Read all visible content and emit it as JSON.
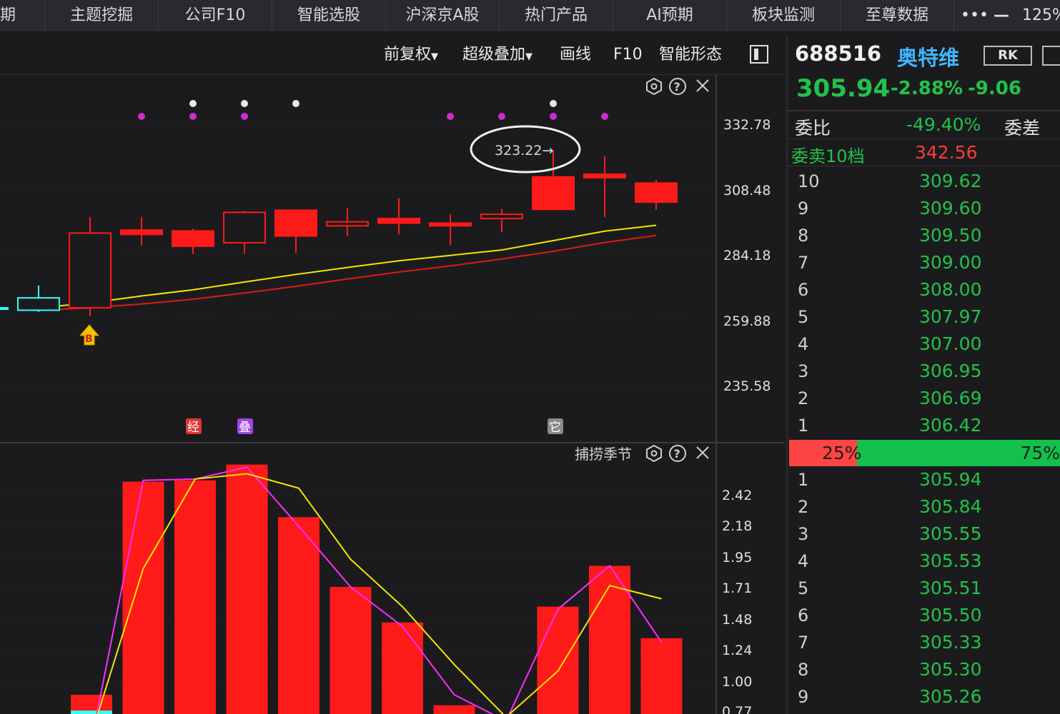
{
  "topnav": {
    "tabs": [
      "期",
      "主题挖掘",
      "公司F10",
      "智能选股",
      "沪深京A股",
      "热门产品",
      "AI预期",
      "板块监测",
      "至尊数据"
    ],
    "more": "•••",
    "minimize": "—",
    "zoom": "125%"
  },
  "toolbar": {
    "adjust": "前复权",
    "overlay": "超级叠加",
    "draw": "画线",
    "f10": "F10",
    "pattern": "智能形态"
  },
  "kline": {
    "yticks": [
      "332.78",
      "308.48",
      "284.18",
      "259.88",
      "235.58"
    ],
    "ylim": [
      235.58,
      332.78
    ],
    "annotation": "323.22→",
    "buy_marker": "B",
    "badges": [
      "经",
      "叠",
      "它"
    ]
  },
  "indicator": {
    "title": "捕捞季节",
    "yticks": [
      "2.42",
      "2.18",
      "1.95",
      "1.71",
      "1.48",
      "1.24",
      "1.00",
      "0.77"
    ],
    "ylim": [
      0.77,
      2.42
    ]
  },
  "quote": {
    "code": "688516",
    "name": "奥特维",
    "rk": "RK",
    "price": "305.94",
    "change_pct": "-2.88%",
    "change": "-9.06",
    "wb_label": "委比",
    "wb_value": "-49.40%",
    "wc_label": "委差",
    "ask10_label": "委卖10档",
    "ask10_value": "342.56",
    "asks": [
      {
        "level": "10",
        "price": "309.62"
      },
      {
        "level": "9",
        "price": "309.60"
      },
      {
        "level": "8",
        "price": "309.50"
      },
      {
        "level": "7",
        "price": "309.00"
      },
      {
        "level": "6",
        "price": "308.00"
      },
      {
        "level": "5",
        "price": "307.97"
      },
      {
        "level": "4",
        "price": "307.00"
      },
      {
        "level": "3",
        "price": "306.95"
      },
      {
        "level": "2",
        "price": "306.69"
      },
      {
        "level": "1",
        "price": "306.42"
      }
    ],
    "sell_ratio": "25%",
    "buy_ratio": "75%",
    "sell_fraction": 0.25,
    "bids": [
      {
        "level": "1",
        "price": "305.94"
      },
      {
        "level": "2",
        "price": "305.84"
      },
      {
        "level": "3",
        "price": "305.55"
      },
      {
        "level": "4",
        "price": "305.53"
      },
      {
        "level": "5",
        "price": "305.51"
      },
      {
        "level": "6",
        "price": "305.50"
      },
      {
        "level": "7",
        "price": "305.33"
      },
      {
        "level": "8",
        "price": "305.30"
      },
      {
        "level": "9",
        "price": "305.26"
      }
    ]
  },
  "colors": {
    "up": "#ff1a1a",
    "down": "#22c24a",
    "ma_yellow": "#f2e600",
    "ma_red": "#e01818",
    "magenta": "#ff2bff",
    "cyan": "#33ffff",
    "name_blue": "#3fb5ff"
  },
  "chart_data": {
    "type": "candlestick",
    "candles": [
      {
        "open": 264.5,
        "close": 264.5,
        "high": 264.5,
        "low": 264.5,
        "color": "cyan"
      },
      {
        "open": 263.6,
        "close": 268.2,
        "high": 272.8,
        "low": 263.0,
        "color": "cyan"
      },
      {
        "open": 264.5,
        "close": 292.3,
        "high": 298.2,
        "low": 261.3,
        "color": "red"
      },
      {
        "open": 293.4,
        "close": 291.8,
        "high": 298.2,
        "low": 287.7,
        "color": "red"
      },
      {
        "open": 293.1,
        "close": 287.4,
        "high": 293.9,
        "low": 284.5,
        "color": "red"
      },
      {
        "open": 288.7,
        "close": 300.0,
        "high": 300.5,
        "low": 284.5,
        "color": "red"
      },
      {
        "open": 300.8,
        "close": 291.2,
        "high": 300.8,
        "low": 284.9,
        "color": "red"
      },
      {
        "open": 295.0,
        "close": 296.5,
        "high": 301.6,
        "low": 291.1,
        "color": "red"
      },
      {
        "open": 297.7,
        "close": 296.0,
        "high": 305.3,
        "low": 291.8,
        "color": "red"
      },
      {
        "open": 296.0,
        "close": 295.0,
        "high": 299.3,
        "low": 287.8,
        "color": "red"
      },
      {
        "open": 297.7,
        "close": 299.3,
        "high": 301.3,
        "low": 292.6,
        "color": "red"
      },
      {
        "open": 313.2,
        "close": 301.1,
        "high": 323.22,
        "low": 301.1,
        "color": "red"
      },
      {
        "open": 314.2,
        "close": 312.9,
        "high": 320.8,
        "low": 298.2,
        "color": "red"
      },
      {
        "open": 310.9,
        "close": 303.8,
        "high": 312.1,
        "low": 301.0,
        "color": "red"
      }
    ],
    "ma_yellow": [
      null,
      264.5,
      266.3,
      268.9,
      271.2,
      274.1,
      276.9,
      279.5,
      282.0,
      284.0,
      286.0,
      289.5,
      293.0,
      295.2
    ],
    "ma_red": [
      null,
      263.5,
      264.5,
      265.9,
      267.7,
      270.0,
      272.5,
      275.2,
      277.8,
      280.1,
      282.7,
      285.5,
      288.8,
      291.4
    ],
    "signal_dots": [
      {
        "index": 3,
        "row": "magenta"
      },
      {
        "index": 4,
        "row": "both"
      },
      {
        "index": 5,
        "row": "both"
      },
      {
        "index": 6,
        "row": "white"
      },
      {
        "index": 9,
        "row": "magenta"
      },
      {
        "index": 10,
        "row": "magenta"
      },
      {
        "index": 11,
        "row": "both"
      },
      {
        "index": 12,
        "row": "magenta"
      }
    ],
    "indicator_bars": [
      {
        "value": 0.9,
        "color": "red"
      },
      {
        "value": 2.52,
        "color": "red"
      },
      {
        "value": 2.53,
        "color": "red"
      },
      {
        "value": 2.65,
        "color": "red"
      },
      {
        "value": 2.25,
        "color": "red"
      },
      {
        "value": 1.72,
        "color": "red"
      },
      {
        "value": 1.45,
        "color": "red"
      },
      {
        "value": 0.82,
        "color": "red"
      },
      {
        "value": null,
        "color": "red"
      },
      {
        "value": 1.57,
        "color": "red"
      },
      {
        "value": 1.88,
        "color": "red"
      },
      {
        "value": 1.33,
        "color": "red"
      }
    ],
    "indicator_cyan_bar": {
      "index": 0,
      "value": 0.78
    },
    "indicator_magenta": [
      0.55,
      2.53,
      2.54,
      2.63,
      2.18,
      1.72,
      1.42,
      0.9,
      0.7,
      1.55,
      1.88,
      1.3
    ],
    "indicator_yellow": [
      0.6,
      1.86,
      2.54,
      2.58,
      2.47,
      1.93,
      1.57,
      1.13,
      0.73,
      1.08,
      1.73,
      1.63
    ],
    "indicator_ylim": [
      0.77,
      2.42
    ]
  }
}
